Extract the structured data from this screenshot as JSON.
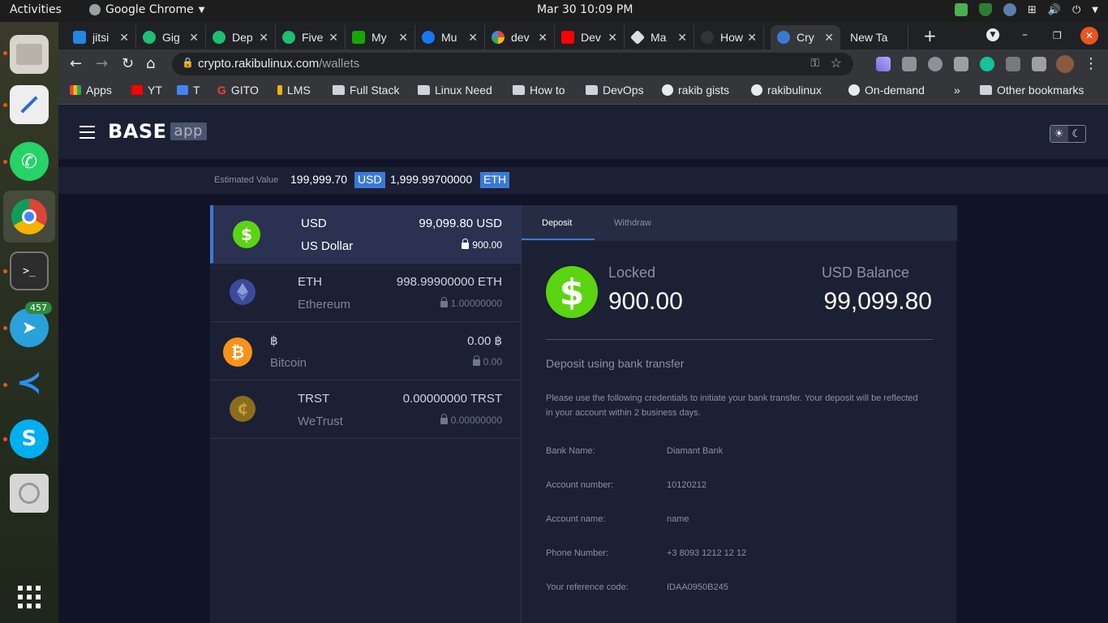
{
  "os": {
    "activities": "Activities",
    "app_name": "Google Chrome",
    "clock": "Mar 30  10:09 PM",
    "dock_badge": "457"
  },
  "browser": {
    "tabs": [
      {
        "label": "jitsi",
        "color": "#1e88e5"
      },
      {
        "label": "Gig",
        "color": "#1dbf73"
      },
      {
        "label": "Dep",
        "color": "#1dbf73"
      },
      {
        "label": "Five",
        "color": "#1dbf73"
      },
      {
        "label": "My",
        "color": "#14a800"
      },
      {
        "label": "Mu",
        "color": "#1877f2"
      },
      {
        "label": "dev",
        "color": "#ffffff"
      },
      {
        "label": "Dev",
        "color": "#ff0000"
      },
      {
        "label": "Ma",
        "color": "#dddddd"
      },
      {
        "label": "How",
        "color": "#333333"
      },
      {
        "label": "Cry",
        "color": "#3c79d6"
      },
      {
        "label": "New Ta",
        "color": ""
      }
    ],
    "url_host": "crypto.rakibulinux.com",
    "url_path": "/wallets",
    "bookmarks": [
      {
        "label": "Apps"
      },
      {
        "label": "YT"
      },
      {
        "label": "T"
      },
      {
        "label": "GITO"
      },
      {
        "label": "LMS"
      },
      {
        "label": "Full Stack"
      },
      {
        "label": "Linux Need"
      },
      {
        "label": "How to"
      },
      {
        "label": "DevOps"
      },
      {
        "label": "rakib gists"
      },
      {
        "label": "rakibulinux"
      },
      {
        "label": "On-demand"
      },
      {
        "label": "»"
      },
      {
        "label": "Other bookmarks"
      }
    ]
  },
  "app": {
    "logo": "BASE",
    "logo_sub": "app",
    "estimated_label": "Estimated Value",
    "estimated_usd": "199,999.70",
    "usd_tag": "USD",
    "estimated_eth": "1,999.99700000",
    "eth_tag": "ETH",
    "wallets": [
      {
        "code": "USD",
        "name": "US Dollar",
        "balance": "99,099.80 USD",
        "locked": "900.00",
        "icon": "$",
        "color": "#5bd412"
      },
      {
        "code": "ETH",
        "name": "Ethereum",
        "balance": "998.99900000 ETH",
        "locked": "1.00000000",
        "icon": "ethereum-icon",
        "color": "#3b4a9a"
      },
      {
        "code": "฿",
        "name": "Bitcoin",
        "balance": "0.00 ฿",
        "locked": "0.00",
        "icon": "₿",
        "color": "#f7931a"
      },
      {
        "code": "TRST",
        "name": "WeTrust",
        "balance": "0.00000000 TRST",
        "locked": "0.00000000",
        "icon": "₵",
        "color": "#8a6d1f"
      }
    ],
    "detail": {
      "tab_deposit": "Deposit",
      "tab_withdraw": "Withdraw",
      "locked_label": "Locked",
      "locked_value": "900.00",
      "balance_label": "USD Balance",
      "balance_value": "99,099.80",
      "deposit_title": "Deposit using bank transfer",
      "deposit_desc": "Please use the following credentials to initiate your bank transfer. Your deposit will be reflected in your account within 2 business days.",
      "fields": [
        {
          "key": "Bank Name:",
          "value": "Diamant Bank"
        },
        {
          "key": "Account number:",
          "value": "10120212"
        },
        {
          "key": "Account name:",
          "value": "name"
        },
        {
          "key": "Phone Number:",
          "value": "+3 8093 1212 12 12"
        },
        {
          "key": "Your reference code:",
          "value": "IDAA0950B245"
        }
      ]
    }
  }
}
